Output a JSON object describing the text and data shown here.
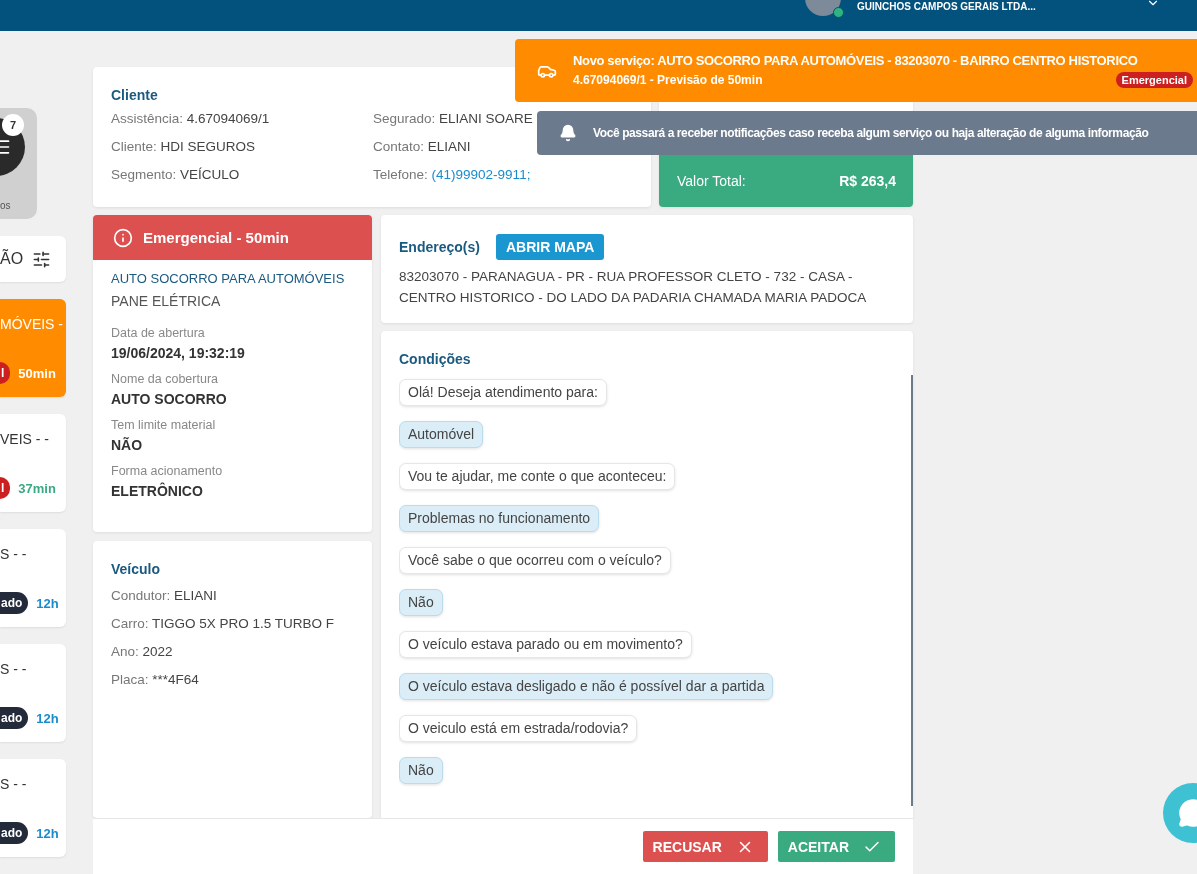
{
  "header": {
    "company": "GUINCHOS CAMPOS GERAIS LTDA..."
  },
  "sidebar": {
    "counter": {
      "badge": "7",
      "label": "os"
    },
    "filter": {
      "label": "ÃO"
    },
    "services": [
      {
        "title": "MÓVEIS -",
        "badge": "l",
        "time": "50min",
        "kind": "emergency",
        "selected": true
      },
      {
        "title": "VEIS - -",
        "badge": "l",
        "time": "37min",
        "kind": "emergency",
        "selected": false
      },
      {
        "title": "S - -",
        "badge": "ado",
        "time": "12h",
        "kind": "scheduled",
        "selected": false
      },
      {
        "title": "S - -",
        "badge": "ado",
        "time": "12h",
        "kind": "scheduled",
        "selected": false
      },
      {
        "title": "S - -",
        "badge": "ado",
        "time": "12h",
        "kind": "scheduled",
        "selected": false
      }
    ]
  },
  "client": {
    "title": "Cliente",
    "columns": [
      [
        {
          "label": "Assistência:",
          "value": "4.67094069/1",
          "kind": "text"
        },
        {
          "label": "Cliente:",
          "value": "HDI SEGUROS",
          "kind": "text"
        },
        {
          "label": "Segmento:",
          "value": "VEÍCULO",
          "kind": "text"
        }
      ],
      [
        {
          "label": "Segurado:",
          "value": "ELIANI SOARE",
          "kind": "text"
        },
        {
          "label": "Contato:",
          "value": "ELIANI",
          "kind": "text"
        },
        {
          "label": "Telefone:",
          "value": "(41)99902-9911;",
          "kind": "link"
        }
      ]
    ]
  },
  "total": {
    "label": "Valor Total:",
    "value": "R$ 263,4"
  },
  "service": {
    "banner": "Emergencial - 50min",
    "name": "AUTO SOCORRO PARA AUTOMÓVEIS",
    "problem": "PANE ELÉTRICA",
    "details": [
      {
        "label": "Data de abertura",
        "value": "19/06/2024, 19:32:19"
      },
      {
        "label": "Nome da cobertura",
        "value": "AUTO SOCORRO"
      },
      {
        "label": "Tem limite material",
        "value": "NÃO"
      },
      {
        "label": "Forma acionamento",
        "value": "ELETRÔNICO"
      }
    ]
  },
  "vehicle": {
    "title": "Veículo",
    "fields": [
      {
        "label": "Condutor:",
        "value": "ELIANI"
      },
      {
        "label": "Carro:",
        "value": "TIGGO 5X PRO 1.5 TURBO F"
      },
      {
        "label": "Ano:",
        "value": "2022"
      },
      {
        "label": "Placa:",
        "value": "***4F64"
      }
    ]
  },
  "address": {
    "title": "Endereço(s)",
    "button": "ABRIR MAPA",
    "text": "83203070 - PARANAGUA - PR - RUA PROFESSOR CLETO - 732 - CASA - CENTRO HISTORICO - DO LADO DA PADARIA CHAMADA MARIA PADOCA"
  },
  "conditions": {
    "title": "Condições",
    "messages": [
      {
        "kind": "question",
        "text": "Olá! Deseja atendimento para:"
      },
      {
        "kind": "answer",
        "text": "Automóvel"
      },
      {
        "kind": "question",
        "text": "Vou te ajudar, me conte o que aconteceu:"
      },
      {
        "kind": "answer",
        "text": "Problemas no funcionamento"
      },
      {
        "kind": "question",
        "text": "Você sabe o que ocorreu com o veículo?"
      },
      {
        "kind": "answer",
        "text": "Não"
      },
      {
        "kind": "question",
        "text": "O veículo estava parado ou em movimento?"
      },
      {
        "kind": "answer",
        "text": "O veículo estava desligado e não é possível dar a partida"
      },
      {
        "kind": "question",
        "text": "O veiculo está em estrada/rodovia?"
      },
      {
        "kind": "answer",
        "text": "Não"
      }
    ]
  },
  "actions": [
    {
      "label": "RECUSAR",
      "kind": "reject"
    },
    {
      "label": "ACEITAR",
      "kind": "accept"
    }
  ],
  "toasts": [
    {
      "kind": "service",
      "title": "Novo serviço: AUTO SOCORRO PARA AUTOMÓVEIS - 83203070 - BAIRRO CENTRO HISTORICO",
      "subtitle": "4.67094069/1 - Previsão de 50min",
      "badge": "Emergencial"
    },
    {
      "kind": "info",
      "text": "Você passará a receber notificações caso receba algum serviço ou haja alteração de alguma informação"
    }
  ]
}
